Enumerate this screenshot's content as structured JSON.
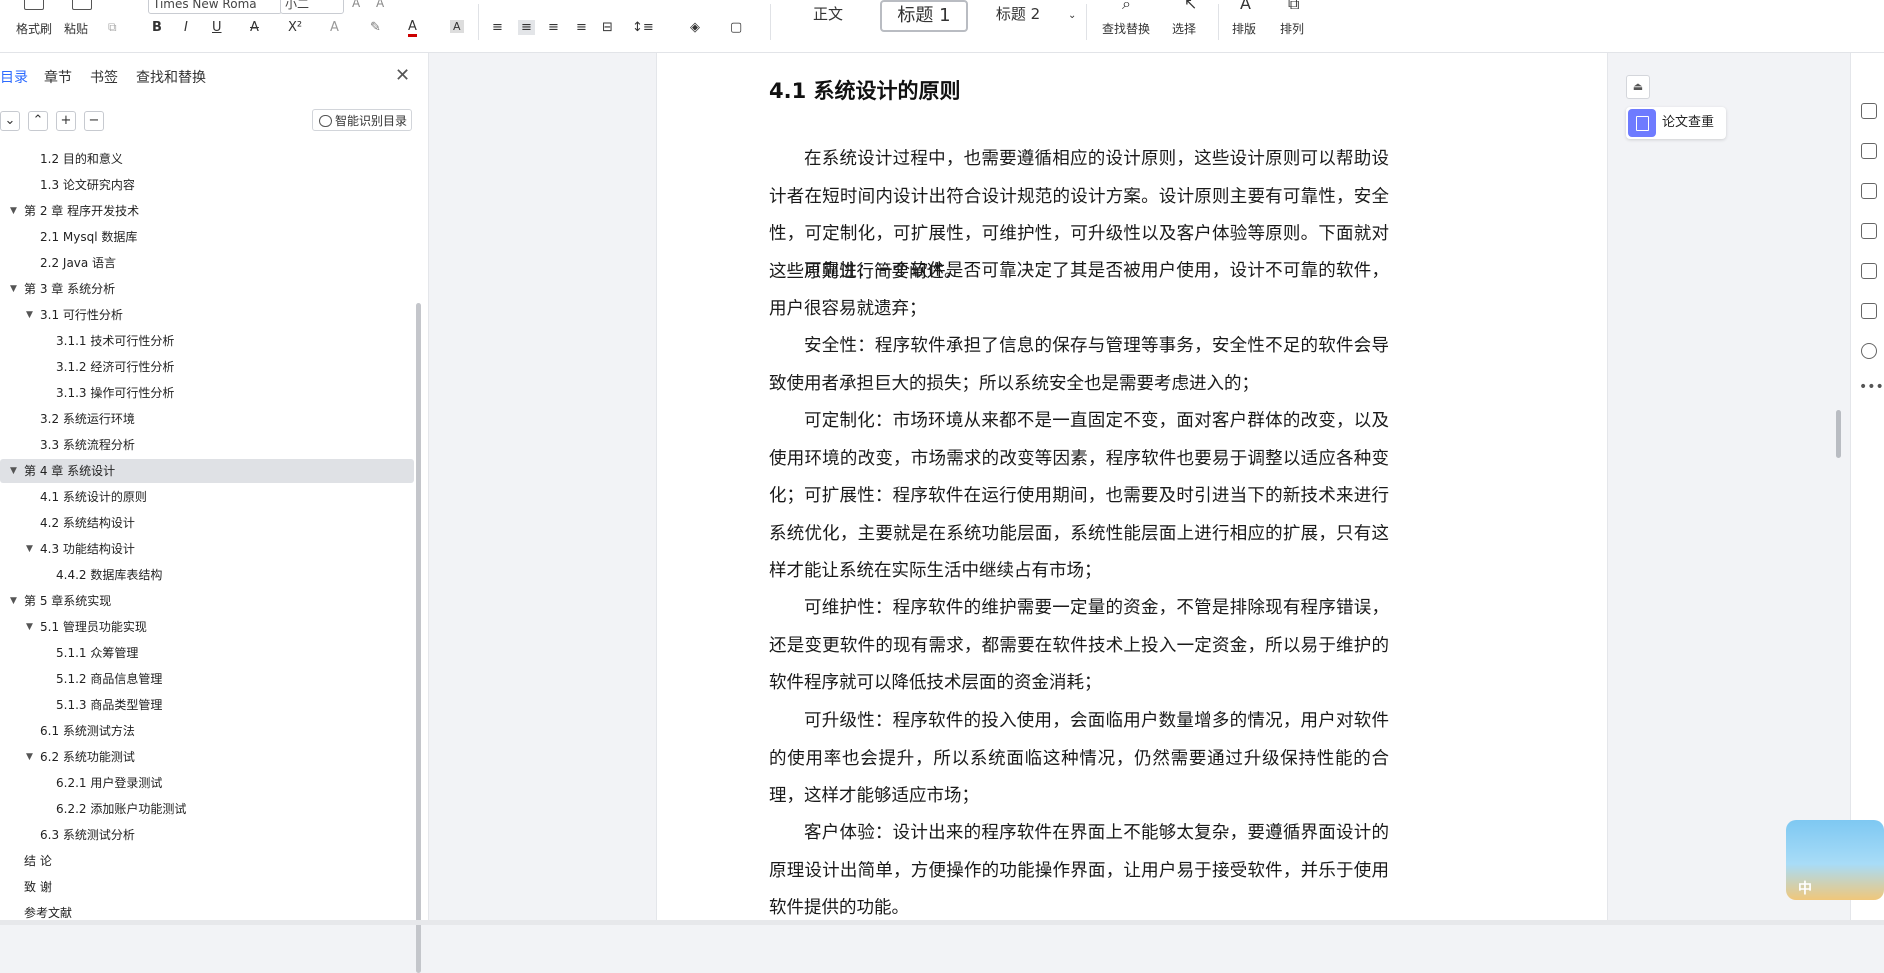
{
  "ribbon": {
    "paste_format": "格式刷",
    "paste": "粘贴",
    "font_name": "Times New Roma",
    "font_size": "小二",
    "bold": "B",
    "italic": "I",
    "underline": "U",
    "strike": "A",
    "superscript": "X²",
    "font_color": "A",
    "highlight": "A",
    "style_normal": "正文",
    "style_h1": "标题 1",
    "style_h2": "标题 2",
    "find_replace": "查找替换",
    "select": "选择",
    "layout": "排版",
    "arrange": "排列"
  },
  "nav": {
    "tabs": [
      "目录",
      "章节",
      "书签",
      "查找和替换"
    ],
    "smart_toc": "智能识别目录",
    "items": [
      {
        "label": "1.2 目的和意义",
        "level": 2,
        "arrow": false
      },
      {
        "label": "1.3  论文研究内容",
        "level": 2,
        "arrow": false
      },
      {
        "label": "第 2 章  程序开发技术",
        "level": 1,
        "arrow": true
      },
      {
        "label": "2.1 Mysql 数据库",
        "level": 2,
        "arrow": false
      },
      {
        "label": "2.2 Java 语言",
        "level": 2,
        "arrow": false
      },
      {
        "label": "第 3 章  系统分析",
        "level": 1,
        "arrow": true
      },
      {
        "label": "3.1 可行性分析",
        "level": 2,
        "arrow": true
      },
      {
        "label": "3.1.1 技术可行性分析",
        "level": 3,
        "arrow": false
      },
      {
        "label": "3.1.2 经济可行性分析",
        "level": 3,
        "arrow": false
      },
      {
        "label": "3.1.3 操作可行性分析",
        "level": 3,
        "arrow": false
      },
      {
        "label": "3.2 系统运行环境",
        "level": 2,
        "arrow": false
      },
      {
        "label": "3.3 系统流程分析",
        "level": 2,
        "arrow": false
      },
      {
        "label": "第 4 章  系统设计",
        "level": 1,
        "arrow": true,
        "selected": true
      },
      {
        "label": "4.1  系统设计的原则",
        "level": 2,
        "arrow": false
      },
      {
        "label": "4.2  系统结构设计",
        "level": 2,
        "arrow": false
      },
      {
        "label": "4.3 功能结构设计",
        "level": 2,
        "arrow": true
      },
      {
        "label": "4.4.2  数据库表结构",
        "level": 3,
        "arrow": false
      },
      {
        "label": "第 5 章系统实现",
        "level": 1,
        "arrow": true
      },
      {
        "label": "5.1 管理员功能实现",
        "level": 2,
        "arrow": true
      },
      {
        "label": "5.1.1  众筹管理",
        "level": 3,
        "arrow": false
      },
      {
        "label": "5.1.2  商品信息管理",
        "level": 3,
        "arrow": false
      },
      {
        "label": "5.1.3 商品类型管理",
        "level": 3,
        "arrow": false
      },
      {
        "label": "6.1 系统测试方法",
        "level": 2,
        "arrow": false
      },
      {
        "label": "6.2  系统功能测试",
        "level": 2,
        "arrow": true
      },
      {
        "label": "6.2.1  用户登录测试",
        "level": 3,
        "arrow": false
      },
      {
        "label": "6.2.2  添加账户功能测试",
        "level": 3,
        "arrow": false
      },
      {
        "label": "6.3  系统测试分析",
        "level": 2,
        "arrow": false
      },
      {
        "label": "结    论",
        "level": 1,
        "arrow": false
      },
      {
        "label": "致    谢",
        "level": 1,
        "arrow": false
      },
      {
        "label": "参考文献",
        "level": 1,
        "arrow": false
      }
    ]
  },
  "document": {
    "heading": "4.1  系统设计的原则",
    "paragraphs": [
      "在系统设计过程中，也需要遵循相应的设计原则，这些设计原则可以帮助设计者在短时间内设计出符合设计规范的设计方案。设计原则主要有可靠性，安全性，可定制化，可扩展性，可维护性，可升级性以及客户体验等原则。下面就对这些原则进行简要阐述。",
      "可靠性：一个软件是否可靠决定了其是否被用户使用，设计不可靠的软件，用户很容易就遗弃；",
      "安全性：程序软件承担了信息的保存与管理等事务，安全性不足的软件会导致使用者承担巨大的损失；所以系统安全也是需要考虑进入的；",
      "可定制化：市场环境从来都不是一直固定不变，面对客户群体的改变，以及使用环境的改变，市场需求的改变等因素，程序软件也要易于调整以适应各种变化；",
      "可扩展性：程序软件在运行使用期间，也需要及时引进当下的新技术来进行系统优化，主要就是在系统功能层面，系统性能层面上进行相应的扩展，只有这样才能让系统在实际生活中继续占有市场；",
      "可维护性：程序软件的维护需要一定量的资金，不管是排除现有程序错误，还是变更软件的现有需求，都需要在软件技术上投入一定资金，所以易于维护的软件程序就可以降低技术层面的资金消耗；",
      "可升级性：程序软件的投入使用，会面临用户数量增多的情况，用户对软件的使用率也会提升，所以系统面临这种情况，仍然需要通过升级保持性能的合理，这样才能够适应市场；",
      "客户体验：设计出来的程序软件在界面上不能够太复杂，要遵循界面设计的原理设计出简单，方便操作的功能操作界面，让用户易于接受软件，并乐于使用软件提供的功能。"
    ]
  },
  "side": {
    "plagiarism_check": "论文查重",
    "widget_text": "中"
  }
}
